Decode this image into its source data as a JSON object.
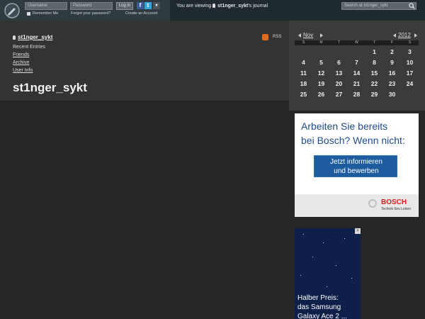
{
  "topbar": {
    "username_placeholder": "Username",
    "password_placeholder": "Password",
    "login_label": "Log in",
    "remember_label": "Remember Me",
    "forgot_label": "Forgot your password?",
    "create_label": "Create an Account",
    "viewing_prefix": "You are viewing",
    "viewing_user": "st1nger_sykt",
    "viewing_suffix": "'s journal",
    "search_placeholder": "Search at st1nger_sykt"
  },
  "journal": {
    "username": "st1nger_sykt",
    "title": "st1nger_sykt",
    "rss_label": "RSS",
    "nav": {
      "recent": "Recent Entries",
      "friends": "Friends",
      "archive": "Archive",
      "userinfo": "User Info"
    }
  },
  "calendar": {
    "month": "Nov",
    "year": "2012",
    "day_names": [
      "S",
      "M",
      "T",
      "W",
      "T",
      "F",
      "S"
    ],
    "weeks": [
      [
        "",
        "",
        "",
        "",
        "1",
        "2",
        "3"
      ],
      [
        "4",
        "5",
        "6",
        "7",
        "8",
        "9",
        "10"
      ],
      [
        "11",
        "12",
        "13",
        "14",
        "15",
        "16",
        "17"
      ],
      [
        "18",
        "19",
        "20",
        "21",
        "22",
        "23",
        "24"
      ],
      [
        "25",
        "26",
        "27",
        "28",
        "29",
        "30",
        ""
      ]
    ]
  },
  "ad1": {
    "line1": "Arbeiten Sie bereits",
    "line2": "bei Bosch? Wenn nicht:",
    "button_line1": "Jetzt informieren",
    "button_line2": "und bewerben",
    "brand": "BOSCH",
    "tagline": "Technik fürs Leben"
  },
  "ad2": {
    "close": "×",
    "line1": "Halber Preis:",
    "line2": "das Samsung",
    "line3": "Galaxy Ace 2 ..."
  },
  "colors": {
    "topbar": "#1e2a30",
    "header": "#333333",
    "sidebar_calendar": "#3b3b3b",
    "bosch_red": "#d8201c",
    "bosch_blue": "#1d5c9e"
  }
}
